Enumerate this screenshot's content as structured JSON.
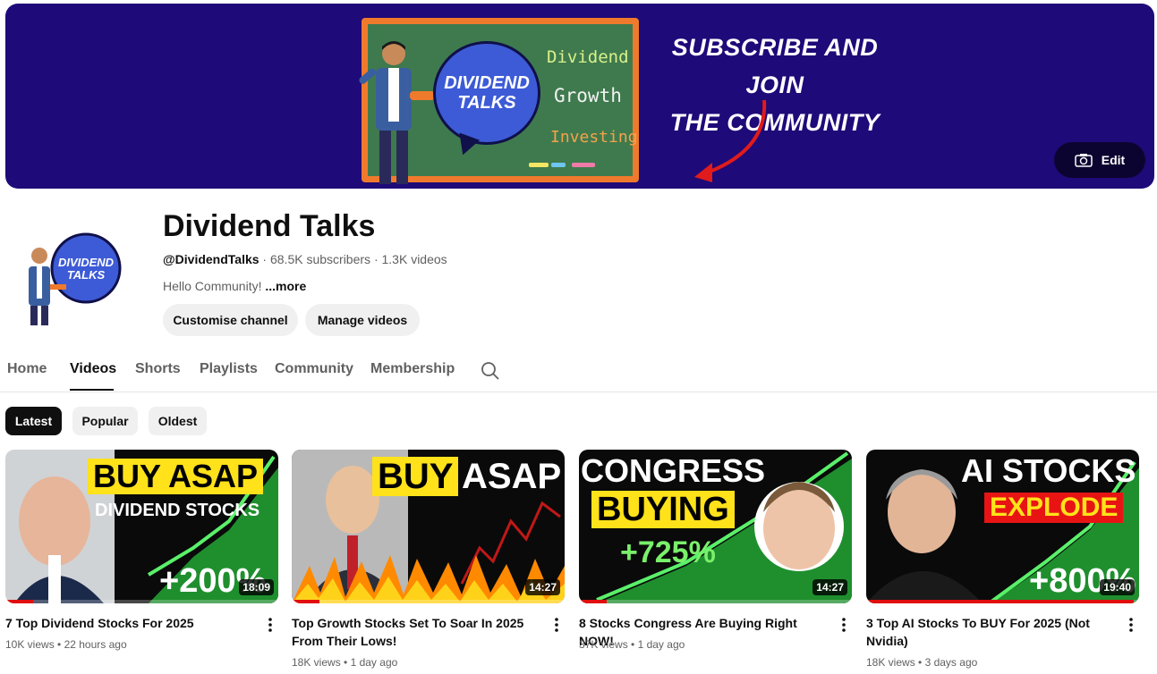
{
  "banner": {
    "board_words": [
      "Dividend",
      "Growth",
      "Investing"
    ],
    "logo_text_line1": "DIVIDEND",
    "logo_text_line2": "TALKS",
    "cta_line1": "SUBSCRIBE AND JOIN",
    "cta_line2": "THE COMMUNITY",
    "edit_label": "Edit",
    "colors": {
      "background": "#1e0a78",
      "board": "#3f7a4e",
      "frame": "#f07a2c",
      "arrow": "#e01b1b"
    }
  },
  "channel": {
    "name": "Dividend Talks",
    "handle": "@DividendTalks",
    "subscribers": "68.5K subscribers",
    "videos_count": "1.3K videos",
    "separator": "·",
    "description": "Hello Community!",
    "more_label": "...more",
    "buttons": [
      "Customise channel",
      "Manage videos"
    ]
  },
  "tabs": {
    "items": [
      "Home",
      "Videos",
      "Shorts",
      "Playlists",
      "Community",
      "Membership"
    ],
    "active": "Videos",
    "search_icon": "search-icon"
  },
  "chips": {
    "items": [
      "Latest",
      "Popular",
      "Oldest"
    ],
    "active": "Latest"
  },
  "videos": [
    {
      "title": "7 Top Dividend Stocks For 2025",
      "views": "10K views",
      "age": "22 hours ago",
      "duration": "18:09",
      "watched_fraction": 0.1,
      "thumb": {
        "line1": "BUY ASAP",
        "line2": "DIVIDEND STOCKS",
        "badge": "+200%"
      }
    },
    {
      "title": "Top Growth Stocks Set To Soar In 2025 From Their Lows!",
      "views": "18K views",
      "age": "1 day ago",
      "duration": "14:27",
      "watched_fraction": 0.1,
      "thumb": {
        "line1": "BUY",
        "line2": "ASAP"
      }
    },
    {
      "title": "8 Stocks Congress Are Buying Right NOW!",
      "views": "37K views",
      "age": "1 day ago",
      "duration": "14:27",
      "watched_fraction": 0.1,
      "thumb": {
        "line1": "CONGRESS",
        "line2": "BUYING",
        "badge": "+725%"
      }
    },
    {
      "title": "3 Top AI Stocks To BUY For 2025 (Not Nvidia)",
      "views": "18K views",
      "age": "3 days ago",
      "duration": "19:40",
      "watched_fraction": 0.98,
      "thumb": {
        "line1": "AI STOCKS",
        "line2": "EXPLODE",
        "badge": "+800%"
      }
    }
  ]
}
